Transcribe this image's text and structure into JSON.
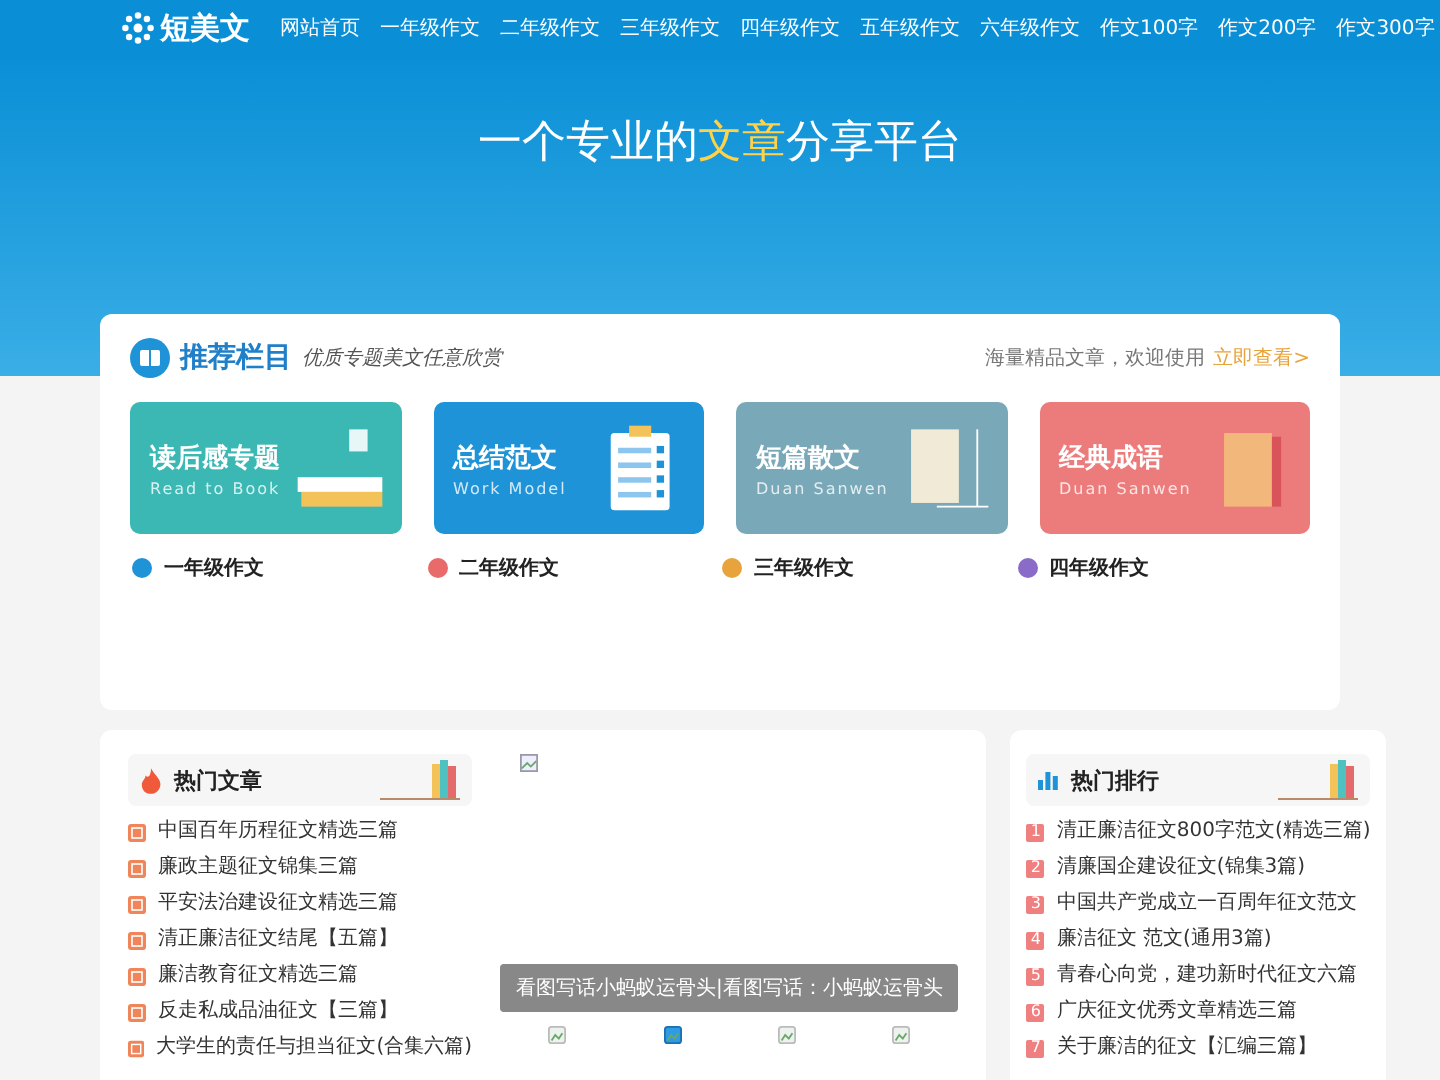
{
  "header": {
    "logo": "短美文",
    "nav": [
      {
        "label": "网站首页",
        "selected": false
      },
      {
        "label": "一年级作文",
        "selected": false
      },
      {
        "label": "二年级作文",
        "selected": false
      },
      {
        "label": "三年级作文",
        "selected": false
      },
      {
        "label": "四年级作文",
        "selected": false
      },
      {
        "label": "五年级作文",
        "selected": false
      },
      {
        "label": "六年级作文",
        "selected": false
      },
      {
        "label": "作文100字",
        "selected": false
      },
      {
        "label": "作文200字",
        "selected": false
      },
      {
        "label": "作文300字",
        "selected": false
      }
    ]
  },
  "hero": {
    "before": "一个专业的",
    "highlight": "文章",
    "after": "分享平台"
  },
  "recommend": {
    "title": "推荐栏目",
    "subtitle": "优质专题美文任意欣赏",
    "note": "海量精品文章，欢迎使用",
    "link": "立即查看>",
    "cards": [
      {
        "kind": "reading",
        "title": "读后感专题",
        "english": "Read to Book",
        "color": "#3bb8b4"
      },
      {
        "kind": "summary",
        "title": "总结范文",
        "english": "Work Model",
        "color": "#1f93d8"
      },
      {
        "kind": "prose",
        "title": "短篇散文",
        "english": "Duan Sanwen",
        "color": "#79a8b8"
      },
      {
        "kind": "idiom",
        "title": "经典成语",
        "english": "Duan Sanwen",
        "color": "#ec7b7b"
      }
    ],
    "categories": [
      {
        "label": "一年级作文",
        "color": "#1f93d8"
      },
      {
        "label": "二年级作文",
        "color": "#e86a6a"
      },
      {
        "label": "三年级作文",
        "color": "#e8a33c"
      },
      {
        "label": "四年级作文",
        "color": "#8a6cc8"
      }
    ]
  },
  "hot": {
    "title": "热门文章",
    "items": [
      "中国百年历程征文精选三篇",
      "廉政主题征文锦集三篇",
      "平安法治建设征文精选三篇",
      "清正廉洁征文结尾【五篇】",
      "廉洁教育征文精选三篇",
      "反走私成品油征文【三篇】",
      "大学生的责任与担当征文(合集六篇)"
    ]
  },
  "slider": {
    "caption": "看图写话小蚂蚁运骨头|看图写话：小蚂蚁运骨头",
    "thumbs": [
      {
        "selected": false
      },
      {
        "selected": true
      },
      {
        "selected": false
      },
      {
        "selected": false
      }
    ]
  },
  "ranking": {
    "title": "热门排行",
    "items": [
      {
        "rank": "1",
        "title": "清正廉洁征文800字范文(精选三篇)"
      },
      {
        "rank": "2",
        "title": "清廉国企建设征文(锦集3篇)"
      },
      {
        "rank": "3",
        "title": "中国共产党成立一百周年征文范文"
      },
      {
        "rank": "4",
        "title": "廉洁征文 范文(通用3篇)"
      },
      {
        "rank": "5",
        "title": "青春心向党，建功新时代征文六篇"
      },
      {
        "rank": "6",
        "title": "广庆征文优秀文章精选三篇"
      },
      {
        "rank": "7",
        "title": "关于廉洁的征文【汇编三篇】"
      }
    ]
  }
}
